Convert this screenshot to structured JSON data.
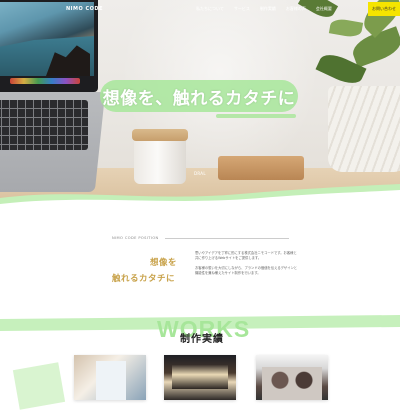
{
  "header": {
    "logo": "NIMO CODE",
    "nav": [
      "私たちについて",
      "サービス",
      "制作実績",
      "お客様の声",
      "会社概要"
    ],
    "cta_label": "お問い合わせ"
  },
  "hero": {
    "headline": "想像を、触れるカタチに",
    "sub_caption": "",
    "product_label": "DRAL"
  },
  "about": {
    "eyebrow": "NIMO CODE POSITION",
    "heading_line1": "想像を",
    "heading_line2": "触れるカタチに",
    "paragraph1": "思いやアイデアを丁寧に形にする株式会社ニモコードです。お客様と共に作り上げるWebサイトをご提供します。",
    "paragraph2": "お客様の想いを大切にしながら、ブランドの価値を伝えるデザインと機能性を兼ね備えたサイト制作を行います。"
  },
  "works": {
    "bg_word": "WORKS",
    "title": "制作実績"
  },
  "colors": {
    "accent_green": "#a7e69a",
    "heading_gold": "#c8a24a",
    "cta_yellow": "#f5e400"
  }
}
